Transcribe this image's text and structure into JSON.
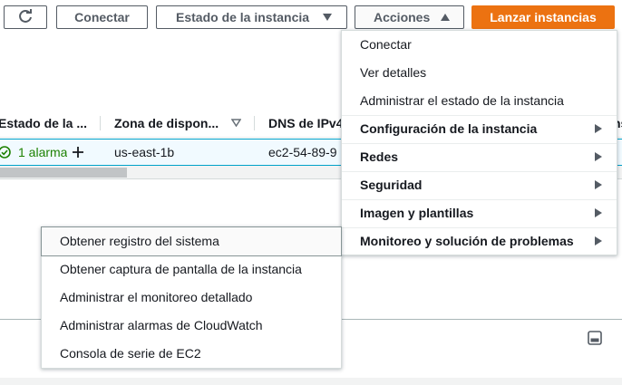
{
  "toolbar": {
    "refresh_icon": "refresh-icon",
    "connect_label": "Conectar",
    "instance_state_label": "Estado de la instancia",
    "actions_label": "Acciones",
    "launch_label": "Lanzar instancias"
  },
  "table": {
    "headers": [
      "Estado de la ...",
      "Zona de dispon...",
      "DNS de IPv4",
      "ns"
    ],
    "row": {
      "alarm": "1 alarma",
      "zone": "us-east-1b",
      "dns": "ec2-54-89-9"
    }
  },
  "actions_menu": {
    "items": [
      {
        "label": "Conectar",
        "bold": false,
        "submenu": false
      },
      {
        "label": "Ver detalles",
        "bold": false,
        "submenu": false
      },
      {
        "label": "Administrar el estado de la instancia",
        "bold": false,
        "submenu": false
      },
      {
        "label": "Configuración de la instancia",
        "bold": true,
        "submenu": true
      },
      {
        "label": "Redes",
        "bold": true,
        "submenu": true
      },
      {
        "label": "Seguridad",
        "bold": true,
        "submenu": true
      },
      {
        "label": "Imagen y plantillas",
        "bold": true,
        "submenu": true
      },
      {
        "label": "Monitoreo y solución de problemas",
        "bold": true,
        "submenu": true
      }
    ]
  },
  "monitor_submenu": {
    "items": [
      "Obtener registro del sistema",
      "Obtener captura de pantalla de la instancia",
      "Administrar el monitoreo detallado",
      "Administrar alarmas de CloudWatch",
      "Consola de serie de EC2"
    ]
  },
  "colors": {
    "primary": "#ec7211",
    "selected_row": "#f1faff",
    "selected_border": "#00a1c9",
    "success": "#1d8102"
  }
}
